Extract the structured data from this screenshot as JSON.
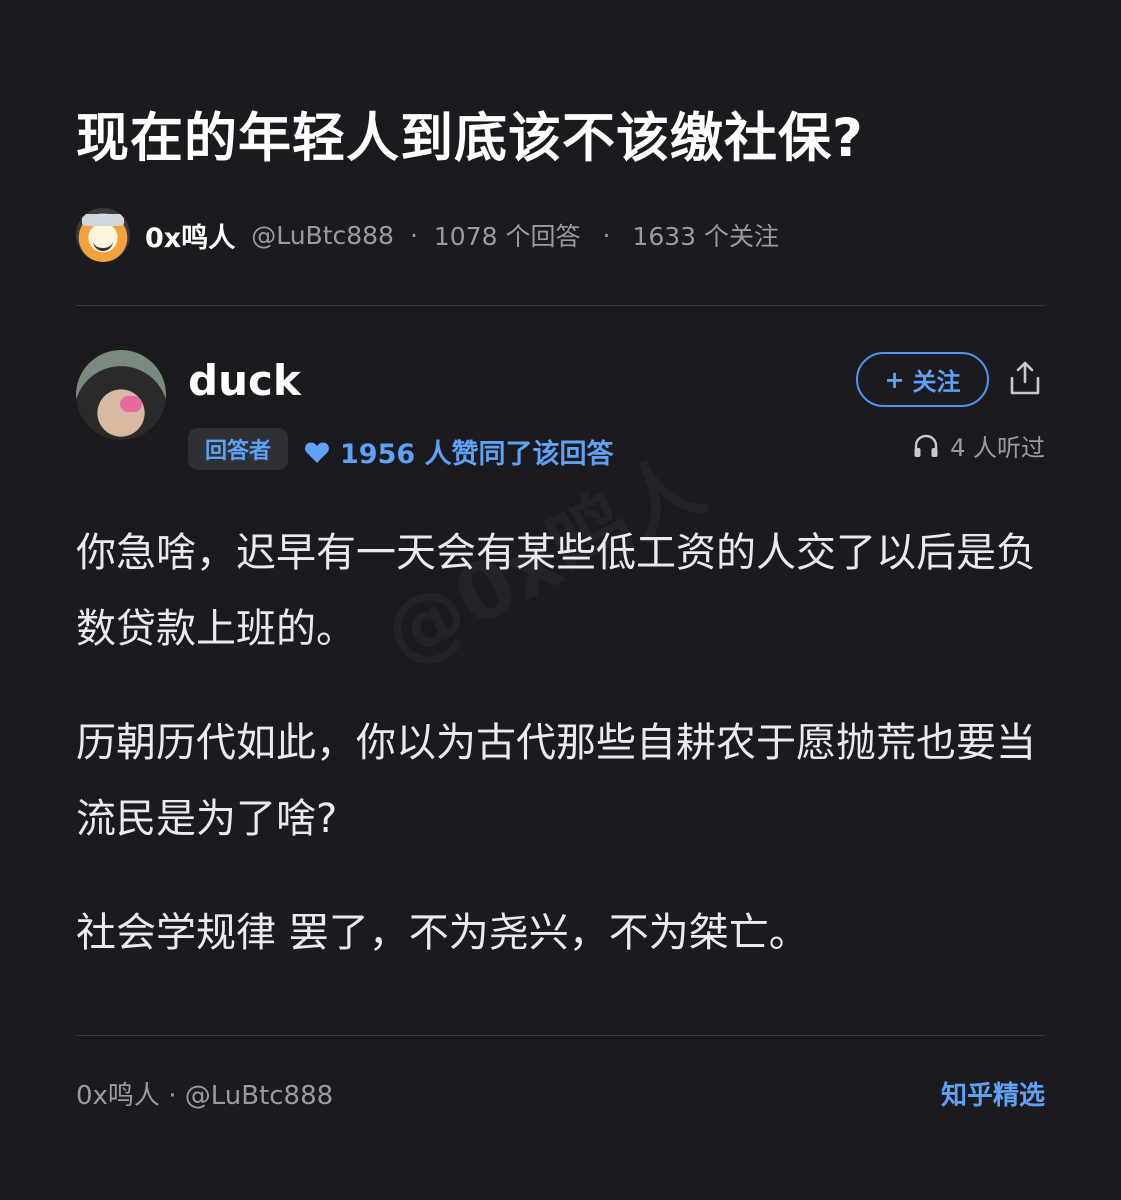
{
  "question": {
    "title": "现在的年轻人到底该不该缴社保?"
  },
  "poster": {
    "avatar_icon": "cartoon-avatar-icon",
    "name": "0x鸣人",
    "handle": "@LuBtc888",
    "separator": "·",
    "answers_count": "1078 个回答",
    "followers_count": "1633 个关注"
  },
  "answer": {
    "author": "duck",
    "role_badge": "回答者",
    "likes_text": "1956 人赞同了该回答",
    "follow_label": "关注",
    "follow_plus": "+",
    "listen_text": "4 人听过",
    "paragraphs": [
      "你急啥，迟早有一天会有某些低工资的人交了以后是负数贷款上班的。",
      "历朝历代如此，你以为古代那些自耕农于愿抛荒也要当流民是为了啥?",
      "社会学规律 罢了，不为尧兴，不为桀亡。"
    ]
  },
  "watermark": "@0x鸣人",
  "footer": {
    "left": "0x鸣人 · @LuBtc888",
    "right": "知乎精选"
  },
  "colors": {
    "background": "#1b1b1f",
    "accent": "#5ea1f5",
    "muted": "#9a9ba0",
    "divider": "#38383d"
  }
}
